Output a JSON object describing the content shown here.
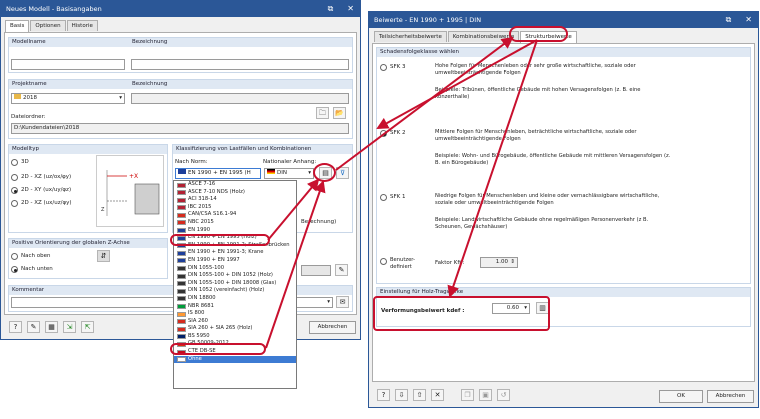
{
  "left_dialog": {
    "title": "Neues Modell - Basisangaben",
    "tabs": [
      "Basis",
      "Optionen",
      "Historie"
    ],
    "modelname_label": "Modellname",
    "bezeichnung_label": "Bezeichnung",
    "projektname_label": "Projektname",
    "projekt_bezeichnung_label": "Bezeichnung",
    "projekt_value": "2018",
    "dateiordner_label": "Dateiordner:",
    "dateiordner_value": "D:\\Kundendateien\\2018",
    "modelltyp_header": "Modelltyp",
    "model_types": [
      "3D",
      "2D - XZ (uz/ox/φy)",
      "2D - XY (ux/uy/φz)",
      "2D - XZ (ux/uz/φy)"
    ],
    "klassifizierung_header": "Klassifizierung von Lastfällen und Kombinationen",
    "nach_norm_label": "Nach Norm:",
    "nationaler_anhang_label": "Nationaler Anhang:",
    "norm_value": "EN 1990 + EN 1995 (H",
    "anhang_value": "DIN",
    "berechnung_partial": "Berechnung)",
    "positive_header": "Positive Orientierung der globalen Z-Achse",
    "orient_options": [
      "Nach oben",
      "Nach unten"
    ],
    "kommentar_header": "Kommentar",
    "abbrechen": "Abbrechen",
    "norm_list": [
      "ASCE 7-16",
      "ASCE 7-10 NDS (Holz)",
      "ACI 318-14",
      "IBC 2015",
      "CAN/CSA S16.1-94",
      "NBC 2015",
      "EN 1990",
      "EN 1990 + EN 1995 (Holz)",
      "EN 1990 + EN 1991-2; Straßenbrücken",
      "EN 1990 + EN 1991-3; Krane",
      "EN 1990 + EN 1997",
      "DIN 1055-100",
      "DIN 1055-100 + DIN 1052 (Holz)",
      "DIN 1055-100 + DIN 18008 (Glas)",
      "DIN 1052 (vereinfacht) (Holz)",
      "DIN 18800",
      "NBR 8681",
      "IS 800",
      "SIA 260",
      "SIA 260 + SIA 265 (Holz)",
      "BS 5950",
      "GB 50009-2012",
      "CTE DB-SE",
      "Ohne"
    ],
    "norm_selected_index": 23
  },
  "right_dialog": {
    "title": "Beiwerte - EN 1990 + 1995 | DIN",
    "tabs": [
      "Teilsicherheitsbeiwerte",
      "Kombinationsbeiwerte",
      "Strukturbeiwerte"
    ],
    "schadens_header": "Schadensfolgeklasse wählen",
    "sfk3_label": "SFK 3",
    "sfk3_text": "Hohe Folgen für Menschenleben oder sehr große wirtschaftliche, soziale oder umweltbeeinträchtigende Folgen",
    "sfk3_example": "Beispiele: Tribünen, öffentliche Gebäude mit hohen Versagensfolgen (z. B. eine Konzerthalle)",
    "sfk2_label": "SFK 2",
    "sfk2_text": "Mittlere Folgen für Menschenleben, beträchtliche wirtschaftliche, soziale oder umweltbeeinträchtigende Folgen",
    "sfk2_example": "Beispiele: Wohn- und Bürogebäude, öffentliche Gebäude mit mittleren Versagensfolgen (z. B. ein Bürogebäude)",
    "sfk1_label": "SFK 1",
    "sfk1_text": "Niedrige Folgen für Menschenleben und kleine oder vernachlässigbare wirtschaftliche, soziale oder umweltbeeinträchtigende Folgen",
    "sfk1_example": "Beispiele: Landwirtschaftliche Gebäude ohne regelmäßigen Personenverkehr (z B. Scheunen, Gewächshäuser)",
    "benutzer_label": "Benutzer-definiert",
    "faktor_label": "Faktor Kfi :",
    "faktor_value": "1.00",
    "holz_header": "Einstellung für Holz-Tragwerke",
    "verformung_label": "Verformungsbeiwert kdef :",
    "verformung_value": "0.60",
    "ok": "OK",
    "abbrechen": "Abbrechen"
  },
  "colors": {
    "title_blue": "#2b5797",
    "highlight_red": "#c8102e",
    "selection_blue": "#3d7bd3",
    "group_header": "#dfe8f3"
  }
}
